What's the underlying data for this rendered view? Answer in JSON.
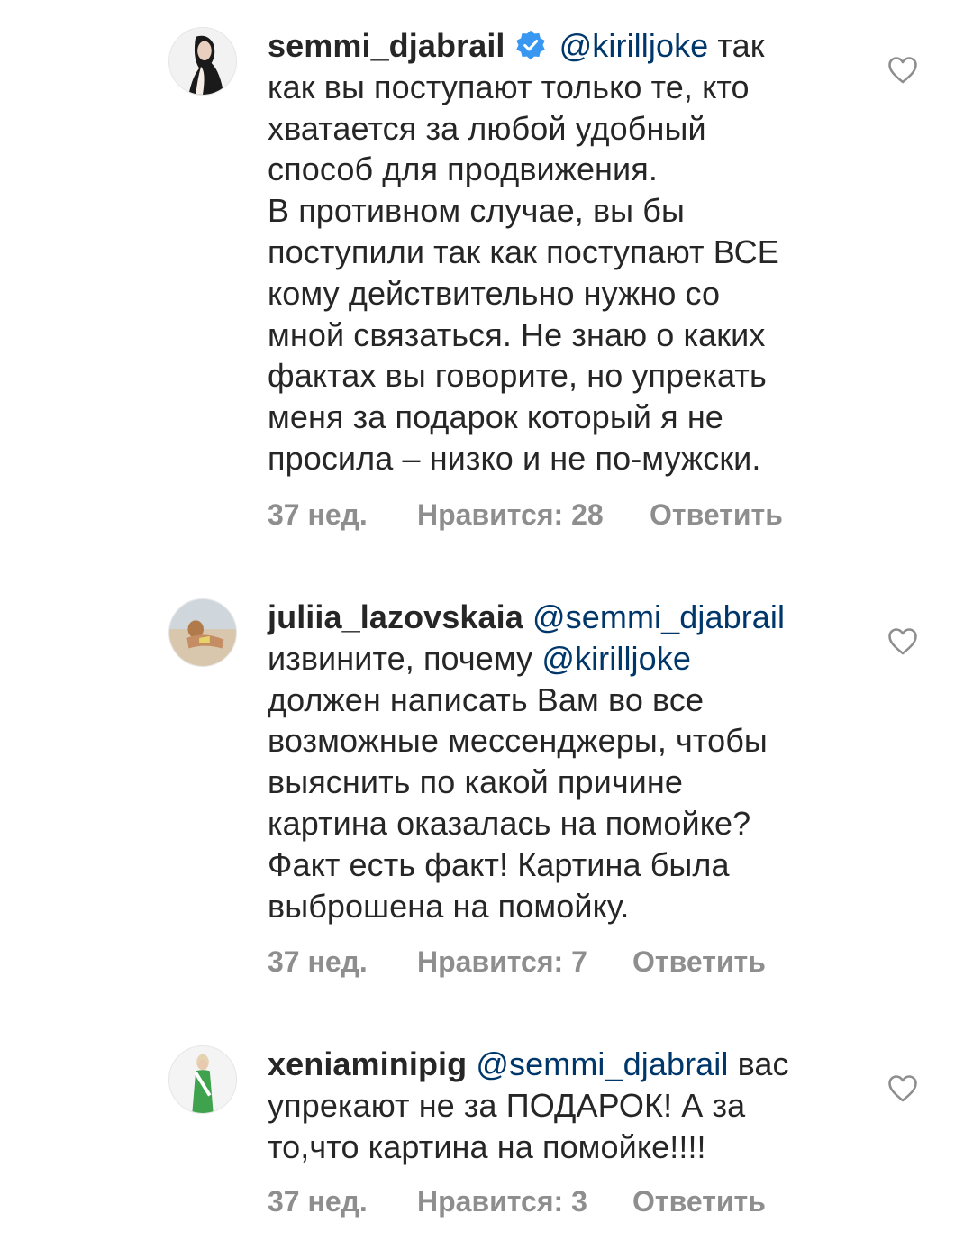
{
  "comments": [
    {
      "username": "semmi_djabrail",
      "verified": true,
      "mention": "@kirilljoke",
      "line0_rest": "так",
      "lines": [
        "как вы поступают только те, кто",
        "хватается за любой удобный",
        "способ для продвижения.",
        "В противном случае, вы бы",
        "поступили так как поступают ВСЕ",
        "кому действительно нужно со",
        "мной связаться. Не знаю о каких",
        "фактах вы говорите, но упрекать",
        "меня за подарок который я не",
        "просила – низко и не по-мужски."
      ],
      "time": "37 нед.",
      "likes": "Нравится: 28",
      "reply": "Ответить"
    },
    {
      "username": "juliia_lazovskaia",
      "verified": false,
      "mention": "@semmi_djabrail",
      "line1_prefix": "извините, почему",
      "line1_mention": "@kirilljoke",
      "lines": [
        "должен написать Вам во все",
        "возможные мессенджеры, чтобы",
        "выяснить по какой причине",
        "картина оказалась на помойке?",
        "Факт есть факт! Картина была",
        "выброшена на помойку."
      ],
      "time": "37 нед.",
      "likes": "Нравится: 7",
      "reply": "Ответить"
    },
    {
      "username": "xeniaminipig",
      "verified": false,
      "mention": "@semmi_djabrail",
      "line0_rest": "вас",
      "lines": [
        "упрекают не за ПОДАРОК! А за",
        "то,что картина на помойке!!!!"
      ],
      "time": "37 нед.",
      "likes": "Нравится: 3",
      "reply": "Ответить"
    }
  ],
  "colors": {
    "text": "#262626",
    "mention": "#00376b",
    "meta": "#8e8e8e",
    "verified": "#3897f0"
  }
}
